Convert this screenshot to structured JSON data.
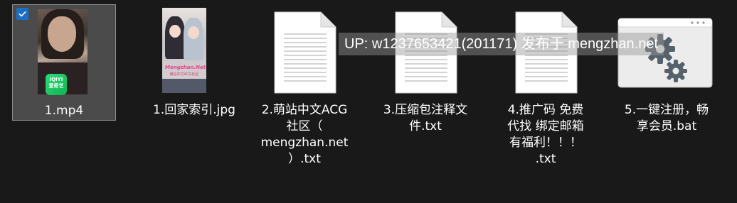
{
  "files": [
    {
      "name": "1.mp4",
      "type": "video",
      "badge": "iQIYI\n爱奇艺"
    },
    {
      "name": "1.回家索引.jpg",
      "type": "image",
      "thumb_title": "Mengzhan.Net",
      "thumb_subtitle": "萌站中文ACG社区"
    },
    {
      "name": "2.萌站中文ACG\n社区（\nmengzhan.net\n）.txt",
      "type": "text"
    },
    {
      "name": "3.压缩包注释文\n件.txt",
      "type": "text"
    },
    {
      "name": "4.推广码 免费\n代找 绑定邮箱\n有福利！！！\n.txt",
      "type": "text"
    },
    {
      "name": "5.一键注册，畅\n享会员.bat",
      "type": "batch"
    }
  ],
  "selected_index": 0,
  "watermark": "UP: w1237653421(201171) 发布于 mengzhan.net",
  "colors": {
    "background": "#191919",
    "selection": "#4b4b4b",
    "checkbox": "#1b6fc7",
    "text": "#ffffff"
  },
  "icons": {
    "checkbox": "checkmark-icon",
    "text_file": "text-document-icon",
    "batch_file": "gear-window-icon"
  }
}
